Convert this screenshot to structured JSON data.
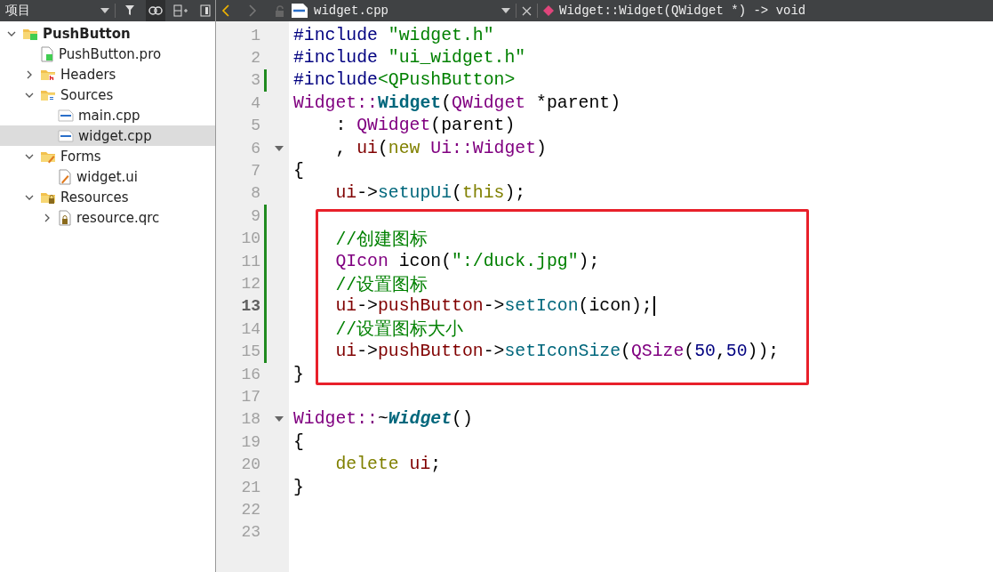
{
  "sidebar": {
    "title": "项目",
    "tree": [
      {
        "label": "PushButton",
        "kind": "project",
        "expanded": true,
        "selected": false,
        "children": [
          {
            "label": "PushButton.pro",
            "kind": "pro",
            "selected": false
          },
          {
            "label": "Headers",
            "kind": "headers",
            "expanded": false,
            "selected": false
          },
          {
            "label": "Sources",
            "kind": "sources",
            "expanded": true,
            "selected": false,
            "children": [
              {
                "label": "main.cpp",
                "kind": "cpp",
                "selected": false
              },
              {
                "label": "widget.cpp",
                "kind": "cpp",
                "selected": true
              }
            ]
          },
          {
            "label": "Forms",
            "kind": "forms",
            "expanded": true,
            "selected": false,
            "children": [
              {
                "label": "widget.ui",
                "kind": "ui",
                "selected": false
              }
            ]
          },
          {
            "label": "Resources",
            "kind": "resources",
            "expanded": true,
            "selected": false,
            "children": [
              {
                "label": "resource.qrc",
                "kind": "qrc",
                "expanded": false,
                "selected": false
              }
            ]
          }
        ]
      }
    ]
  },
  "editor_toolbar": {
    "file": "widget.cpp",
    "symbol": "Widget::Widget(QWidget *) -> void"
  },
  "code": [
    {
      "number": "1",
      "changed": false,
      "current": false,
      "foldable": false,
      "highlighted": false,
      "tokens": [
        {
          "kind": "preproc",
          "text": "#include "
        },
        {
          "kind": "string",
          "text": "\"widget.h\""
        }
      ]
    },
    {
      "number": "2",
      "changed": false,
      "current": false,
      "foldable": false,
      "highlighted": false,
      "tokens": [
        {
          "kind": "preproc",
          "text": "#include "
        },
        {
          "kind": "string",
          "text": "\"ui_widget.h\""
        }
      ]
    },
    {
      "number": "3",
      "changed": true,
      "current": false,
      "foldable": false,
      "highlighted": false,
      "tokens": [
        {
          "kind": "preproc",
          "text": "#include"
        },
        {
          "kind": "string",
          "text": "<QPushButton>"
        }
      ]
    },
    {
      "number": "4",
      "changed": false,
      "current": false,
      "foldable": false,
      "highlighted": false,
      "tokens": [
        {
          "kind": "type",
          "text": "Widget::"
        },
        {
          "kind": "decl",
          "text": "Widget"
        },
        {
          "kind": "plain",
          "text": "("
        },
        {
          "kind": "type",
          "text": "QWidget"
        },
        {
          "kind": "plain",
          "text": " *parent)"
        }
      ]
    },
    {
      "number": "5",
      "changed": false,
      "current": false,
      "foldable": false,
      "highlighted": false,
      "tokens": [
        {
          "kind": "plain",
          "text": "    : "
        },
        {
          "kind": "type",
          "text": "QWidget"
        },
        {
          "kind": "plain",
          "text": "(parent)"
        }
      ]
    },
    {
      "number": "6",
      "changed": false,
      "current": false,
      "foldable": true,
      "highlighted": false,
      "tokens": [
        {
          "kind": "plain",
          "text": "    , "
        },
        {
          "kind": "member",
          "text": "ui"
        },
        {
          "kind": "plain",
          "text": "("
        },
        {
          "kind": "keyword",
          "text": "new"
        },
        {
          "kind": "type",
          "text": " Ui::Widget"
        },
        {
          "kind": "plain",
          "text": ")"
        }
      ]
    },
    {
      "number": "7",
      "changed": false,
      "current": false,
      "foldable": false,
      "highlighted": false,
      "tokens": [
        {
          "kind": "plain",
          "text": "{"
        }
      ]
    },
    {
      "number": "8",
      "changed": false,
      "current": false,
      "foldable": false,
      "highlighted": false,
      "tokens": [
        {
          "kind": "member",
          "text": "    ui"
        },
        {
          "kind": "plain",
          "text": "->"
        },
        {
          "kind": "func",
          "text": "setupUi"
        },
        {
          "kind": "plain",
          "text": "("
        },
        {
          "kind": "keyword",
          "text": "this"
        },
        {
          "kind": "plain",
          "text": ");"
        }
      ]
    },
    {
      "number": "9",
      "changed": true,
      "current": false,
      "foldable": false,
      "highlighted": false
    },
    {
      "number": "10",
      "changed": true,
      "current": false,
      "foldable": false,
      "highlighted": true,
      "tokens": [
        {
          "kind": "comment",
          "text": "    //创建图标"
        }
      ]
    },
    {
      "number": "11",
      "changed": true,
      "current": false,
      "foldable": false,
      "highlighted": true,
      "tokens": [
        {
          "kind": "type",
          "text": "    QIcon"
        },
        {
          "kind": "plain",
          "text": " icon("
        },
        {
          "kind": "string",
          "text": "\":/duck.jpg\""
        },
        {
          "kind": "plain",
          "text": ");"
        }
      ]
    },
    {
      "number": "12",
      "changed": true,
      "current": false,
      "foldable": false,
      "highlighted": true,
      "tokens": [
        {
          "kind": "comment",
          "text": "    //设置图标"
        }
      ]
    },
    {
      "number": "13",
      "changed": true,
      "current": true,
      "foldable": false,
      "highlighted": true,
      "tokens": [
        {
          "kind": "member",
          "text": "    ui"
        },
        {
          "kind": "plain",
          "text": "->"
        },
        {
          "kind": "member",
          "text": "pushButton"
        },
        {
          "kind": "plain",
          "text": "->"
        },
        {
          "kind": "func",
          "text": "setIcon"
        },
        {
          "kind": "plain",
          "text": "(icon);"
        }
      ]
    },
    {
      "number": "14",
      "changed": true,
      "current": false,
      "foldable": false,
      "highlighted": true,
      "tokens": [
        {
          "kind": "comment",
          "text": "    //设置图标大小"
        }
      ]
    },
    {
      "number": "15",
      "changed": true,
      "current": false,
      "foldable": false,
      "highlighted": true,
      "tokens": [
        {
          "kind": "member",
          "text": "    ui"
        },
        {
          "kind": "plain",
          "text": "->"
        },
        {
          "kind": "member",
          "text": "pushButton"
        },
        {
          "kind": "plain",
          "text": "->"
        },
        {
          "kind": "func",
          "text": "setIconSize"
        },
        {
          "kind": "plain",
          "text": "("
        },
        {
          "kind": "type",
          "text": "QSize"
        },
        {
          "kind": "plain",
          "text": "("
        },
        {
          "kind": "number",
          "text": "50"
        },
        {
          "kind": "plain",
          "text": ","
        },
        {
          "kind": "number",
          "text": "50"
        },
        {
          "kind": "plain",
          "text": "));"
        }
      ]
    },
    {
      "number": "16",
      "changed": false,
      "current": false,
      "foldable": false,
      "highlighted": false,
      "tokens": [
        {
          "kind": "plain",
          "text": "}"
        }
      ]
    },
    {
      "number": "17",
      "changed": false,
      "current": false,
      "foldable": false,
      "highlighted": false
    },
    {
      "number": "18",
      "changed": false,
      "current": false,
      "foldable": true,
      "highlighted": false,
      "tokens": [
        {
          "kind": "type",
          "text": "Widget::"
        },
        {
          "kind": "plain",
          "text": "~"
        },
        {
          "kind": "dtor",
          "text": "Widget"
        },
        {
          "kind": "plain",
          "text": "()"
        }
      ]
    },
    {
      "number": "19",
      "changed": false,
      "current": false,
      "foldable": false,
      "highlighted": false,
      "tokens": [
        {
          "kind": "plain",
          "text": "{"
        }
      ]
    },
    {
      "number": "20",
      "changed": false,
      "current": false,
      "foldable": false,
      "highlighted": false,
      "tokens": [
        {
          "kind": "keyword",
          "text": "    delete"
        },
        {
          "kind": "member",
          "text": " ui"
        },
        {
          "kind": "plain",
          "text": ";"
        }
      ]
    },
    {
      "number": "21",
      "changed": false,
      "current": false,
      "foldable": false,
      "highlighted": false,
      "tokens": [
        {
          "kind": "plain",
          "text": "}"
        }
      ]
    },
    {
      "number": "22",
      "changed": false,
      "current": false,
      "foldable": false,
      "highlighted": false
    },
    {
      "number": "23",
      "changed": false,
      "current": false,
      "foldable": false,
      "highlighted": false
    }
  ]
}
